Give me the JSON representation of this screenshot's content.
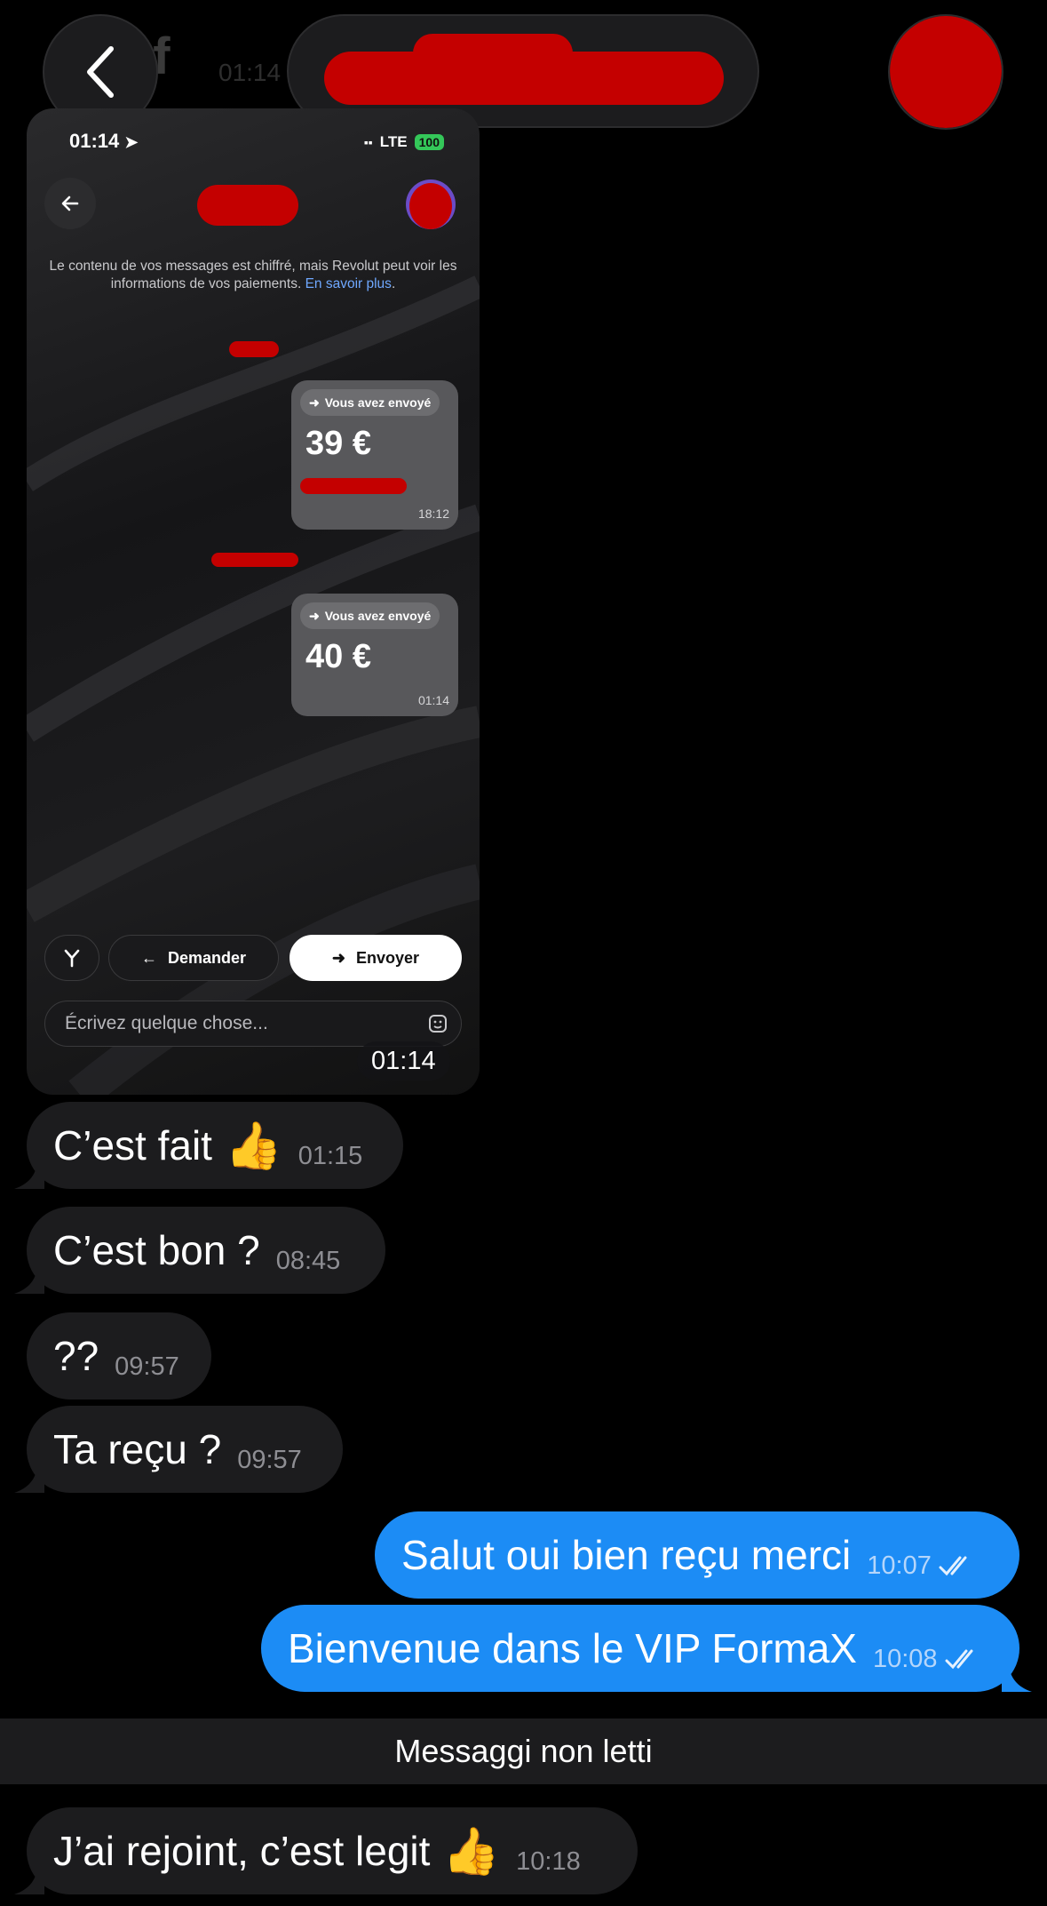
{
  "header": {
    "ghost_title": "ef",
    "ghost_time": "01:14",
    "back_icon": "chevron-left-icon"
  },
  "embedded_screenshot": {
    "status_time": "01:14",
    "network": "LTE",
    "battery": "100",
    "notice_text": "Le contenu de vos messages est chiffré, mais Revolut peut voir les informations de vos paiements.",
    "notice_link": "En savoir plus",
    "notice_end": ".",
    "payments": [
      {
        "chip_label": "Vous avez envoyé",
        "amount": "39 €",
        "time": "18:12"
      },
      {
        "chip_label": "Vous avez envoyé",
        "amount": "40 €",
        "time": "01:14"
      }
    ],
    "buttons": {
      "request_label": "Demander",
      "send_label": "Envoyer"
    },
    "input_placeholder": "Écrivez quelque chose...",
    "photo_time": "01:14"
  },
  "messages": [
    {
      "text": "C’est fait",
      "emoji": "👍",
      "time": "01:15",
      "direction": "in"
    },
    {
      "text": "C’est bon ?",
      "time": "08:45",
      "direction": "in"
    },
    {
      "text": "??",
      "time": "09:57",
      "direction": "in"
    },
    {
      "text": "Ta reçu ?",
      "time": "09:57",
      "direction": "in"
    },
    {
      "text": "Salut oui bien reçu merci",
      "time": "10:07",
      "direction": "out"
    },
    {
      "text": "Bienvenue dans le VIP FormaX",
      "time": "10:08",
      "direction": "out"
    },
    {
      "text": "J’ai rejoint, c’est legit",
      "emoji": "👍",
      "time": "10:18",
      "direction": "in"
    }
  ],
  "unread_divider": "Messaggi non letti",
  "colors": {
    "outgoing_bubble": "#1c8cf5",
    "incoming_bubble": "#1c1c1e",
    "background": "#000000",
    "redaction": "#c40000"
  }
}
